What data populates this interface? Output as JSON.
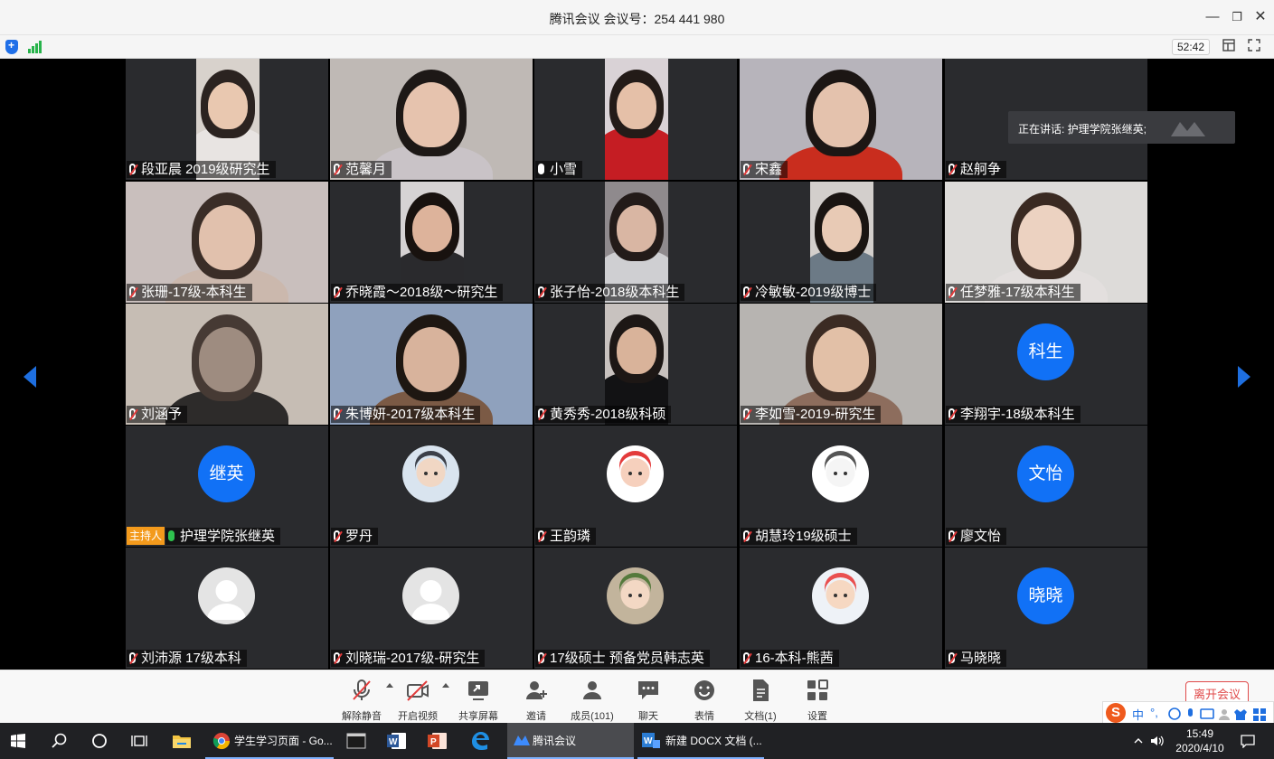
{
  "window": {
    "title": "腾讯会议 会议号：254 441 980",
    "minimize": "—",
    "maximize": "❐",
    "close": "✕"
  },
  "status": {
    "timer": "52:42"
  },
  "speaking": {
    "text": "正在讲话: 护理学院张继英;"
  },
  "host_badge": "主持人",
  "participants": [
    {
      "name": "段亚晨 2019级研究生",
      "mic": "muted",
      "type": "video"
    },
    {
      "name": "范馨月",
      "mic": "muted",
      "type": "video"
    },
    {
      "name": "小雪",
      "mic": "on",
      "type": "video"
    },
    {
      "name": "宋鑫",
      "mic": "muted",
      "type": "video"
    },
    {
      "name": "赵舸争",
      "mic": "muted",
      "type": "blank"
    },
    {
      "name": "张珊-17级-本科生",
      "mic": "muted",
      "type": "video"
    },
    {
      "name": "乔晓霞～2018级～研究生",
      "mic": "muted",
      "type": "video"
    },
    {
      "name": "张子怡-2018级本科生",
      "mic": "muted",
      "type": "video"
    },
    {
      "name": "冷敏敏-2019级博士",
      "mic": "muted",
      "type": "video"
    },
    {
      "name": "任梦雅-17级本科生",
      "mic": "muted",
      "type": "video"
    },
    {
      "name": "刘涵予",
      "mic": "muted",
      "type": "video"
    },
    {
      "name": "朱博妍-2017级本科生",
      "mic": "muted",
      "type": "video"
    },
    {
      "name": "黄秀秀-2018级科硕",
      "mic": "muted",
      "type": "video"
    },
    {
      "name": "李如雪-2019-研究生",
      "mic": "muted",
      "type": "video"
    },
    {
      "name": "李翔宇-18级本科生",
      "mic": "muted",
      "type": "avatar-text",
      "avatar": "科生"
    },
    {
      "name": "护理学院张继英",
      "mic": "green",
      "type": "avatar-text",
      "avatar": "继英",
      "host": true
    },
    {
      "name": "罗丹",
      "mic": "muted",
      "type": "avatar-img"
    },
    {
      "name": "王韵璘",
      "mic": "muted",
      "type": "avatar-img"
    },
    {
      "name": "胡慧玲19级硕士",
      "mic": "muted",
      "type": "avatar-img"
    },
    {
      "name": "廖文怡",
      "mic": "muted",
      "type": "avatar-text",
      "avatar": "文怡"
    },
    {
      "name": "刘沛源  17级本科",
      "mic": "muted",
      "type": "avatar-img"
    },
    {
      "name": "刘晓瑞-2017级-研究生",
      "mic": "muted",
      "type": "avatar-img"
    },
    {
      "name": "17级硕士 预备党员韩志英",
      "mic": "muted",
      "type": "avatar-img"
    },
    {
      "name": "16-本科-熊茜",
      "mic": "muted",
      "type": "avatar-img"
    },
    {
      "name": "马晓晓",
      "mic": "muted",
      "type": "avatar-text",
      "avatar": "晓晓"
    }
  ],
  "toolbar": {
    "unmute": "解除静音",
    "start_video": "开启视频",
    "share_screen": "共享屏幕",
    "invite": "邀请",
    "members": "成员(101)",
    "chat": "聊天",
    "reactions": "表情",
    "docs": "文档(1)",
    "settings": "设置",
    "leave": "离开会议"
  },
  "ime": {
    "logo": "S",
    "lang": "中",
    "punct": "°,"
  },
  "taskbar": {
    "items": [
      {
        "label": "学生学习页面 - Go..."
      },
      {
        "label": "腾讯会议"
      },
      {
        "label": "新建 DOCX 文档 (..."
      }
    ],
    "time": "15:49",
    "date": "2020/4/10"
  },
  "colors": {
    "accent": "#1171f6",
    "host_badge": "#f39a1c",
    "leave": "#e04a4a",
    "muted_red": "#e23b3b"
  }
}
